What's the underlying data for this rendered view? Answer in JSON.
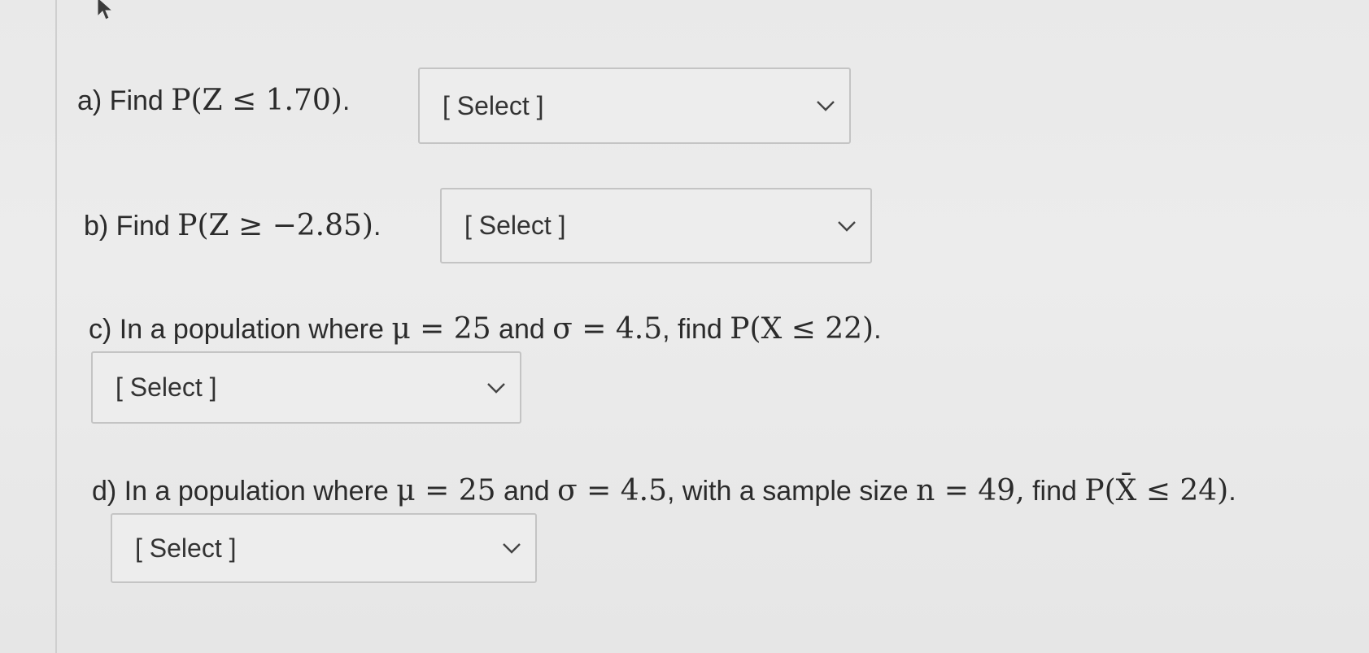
{
  "questions": {
    "a": {
      "label": "a) Find ",
      "expr": "P(Z ≤ 1.70)",
      "end": ".",
      "select": "[ Select ]"
    },
    "b": {
      "label": "b) Find ",
      "expr": "P(Z ≥ −2.85)",
      "end": ".",
      "select": "[ Select ]"
    },
    "c": {
      "prefix": "c) In a population where ",
      "mu_expr": "μ = 25",
      "mid1": " and ",
      "sigma_expr": "σ = 4.5",
      "mid2": ", find ",
      "prob_expr": "P(X ≤ 22)",
      "end": ".",
      "select": "[ Select ]"
    },
    "d": {
      "prefix": "d) In a population where ",
      "mu_expr": "μ = 25",
      "mid1": " and ",
      "sigma_expr": "σ = 4.5",
      "mid2": ", with a sample size ",
      "n_expr": "n = 49,",
      "mid3": "  find ",
      "prob_expr": "P(X̄ ≤ 24)",
      "end": ".",
      "select": "[ Select ]"
    }
  },
  "icons": {
    "cursor": "mouse-pointer-icon",
    "dropdown": "chevron-down-icon"
  }
}
